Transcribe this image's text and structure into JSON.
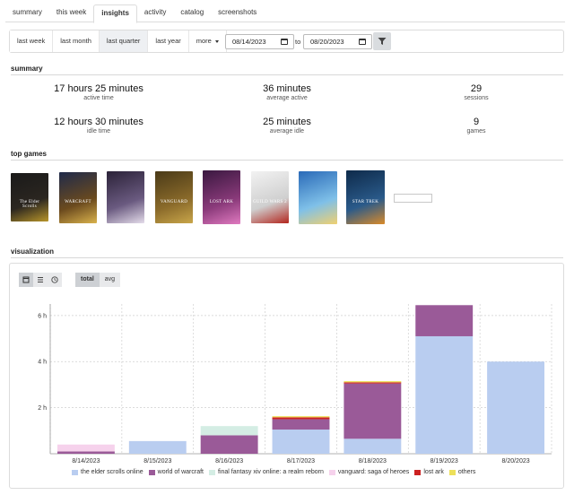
{
  "tabs": [
    {
      "label": "summary",
      "active": false
    },
    {
      "label": "this week",
      "active": false
    },
    {
      "label": "insights",
      "active": true
    },
    {
      "label": "activity",
      "active": false
    },
    {
      "label": "catalog",
      "active": false
    },
    {
      "label": "screenshots",
      "active": false
    }
  ],
  "filters": {
    "ranges": [
      "last week",
      "last month",
      "last quarter",
      "last year"
    ],
    "selected_range": "last quarter",
    "more_label": "more",
    "start_date": "08/14/2023",
    "to_label": "to",
    "end_date": "08/20/2023"
  },
  "summary": {
    "heading": "summary",
    "active_time": {
      "value": "17 hours 25 minutes",
      "label": "active time"
    },
    "average_active": {
      "value": "36 minutes",
      "label": "average active"
    },
    "sessions": {
      "value": "29",
      "label": "sessions"
    },
    "idle_time": {
      "value": "12 hours 30 minutes",
      "label": "idle time"
    },
    "average_idle": {
      "value": "25 minutes",
      "label": "average idle"
    },
    "games": {
      "value": "9",
      "label": "games"
    }
  },
  "top_games": {
    "heading": "top games",
    "covers": [
      {
        "name": "The Elder Scrolls Online",
        "cover_text": "The Elder Scrolls",
        "colors": [
          "#1a1a1a",
          "#2b2620",
          "#b8952a"
        ]
      },
      {
        "name": "World of Warcraft",
        "cover_text": "WARCRAFT",
        "colors": [
          "#1f2a4a",
          "#6b4a1e",
          "#d9b24c"
        ]
      },
      {
        "name": "Final Fantasy XIV Online",
        "cover_text": "",
        "colors": [
          "#2b2238",
          "#6a5a80",
          "#e4dcea"
        ]
      },
      {
        "name": "Vanguard: Saga of Heroes",
        "cover_text": "VANGUARD",
        "colors": [
          "#4a3a18",
          "#8a6a2a",
          "#c9a64a"
        ]
      },
      {
        "name": "Lost Ark",
        "cover_text": "LOST ARK",
        "colors": [
          "#3a1840",
          "#8a3a7a",
          "#e07ac0"
        ]
      },
      {
        "name": "Guild Wars 2",
        "cover_text": "GUILD WARS 2",
        "colors": [
          "#f2f2f2",
          "#cfcfcf",
          "#b3261e"
        ]
      },
      {
        "name": "Unknown game",
        "cover_text": "",
        "colors": [
          "#2a6ab8",
          "#7fc0e8",
          "#f0d070"
        ]
      },
      {
        "name": "Star Trek Online",
        "cover_text": "STAR TREK",
        "colors": [
          "#0e2a4a",
          "#2a5a8a",
          "#d98a2a"
        ]
      }
    ]
  },
  "visualization": {
    "heading": "visualization",
    "view_icons": [
      "calendar-icon",
      "list-icon",
      "clock-icon"
    ],
    "mode_labels": [
      "total",
      "avg"
    ],
    "selected_mode": "total"
  },
  "colors": {
    "eso": "#b9cdf0",
    "wow": "#9a5a98",
    "ffxiv": "#d4ede4",
    "vanguard": "#f6d2ec",
    "lostark": "#cc2222",
    "others": "#ede05a"
  },
  "chart_data": {
    "type": "bar",
    "stacked": true,
    "categories": [
      "8/14/2023",
      "8/15/2023",
      "8/16/2023",
      "8/17/2023",
      "8/18/2023",
      "8/19/2023",
      "8/20/2023"
    ],
    "series": [
      {
        "name": "the elder scrolls online",
        "color_key": "eso",
        "values": [
          0.0,
          0.55,
          0.0,
          1.05,
          0.65,
          5.1,
          4.0
        ]
      },
      {
        "name": "world of warcraft",
        "color_key": "wow",
        "values": [
          0.1,
          0.0,
          0.8,
          0.45,
          2.4,
          1.35,
          0.0
        ]
      },
      {
        "name": "final fantasy xiv online: a realm reborn",
        "color_key": "ffxiv",
        "values": [
          0.0,
          0.0,
          0.4,
          0.0,
          0.0,
          0.0,
          0.0
        ]
      },
      {
        "name": "vanguard: saga of heroes",
        "color_key": "vanguard",
        "values": [
          0.3,
          0.0,
          0.0,
          0.0,
          0.0,
          0.0,
          0.0
        ]
      },
      {
        "name": "lost ark",
        "color_key": "lostark",
        "values": [
          0.0,
          0.0,
          0.0,
          0.08,
          0.05,
          0.0,
          0.0
        ]
      },
      {
        "name": "others",
        "color_key": "others",
        "values": [
          0.0,
          0.0,
          0.0,
          0.05,
          0.05,
          0.0,
          0.0
        ]
      }
    ],
    "y_ticks": [
      2,
      4,
      6
    ],
    "y_tick_labels": [
      "2 h",
      "4 h",
      "6 h"
    ],
    "ylim": [
      0,
      6.5
    ],
    "grid": true,
    "legend_position": "bottom"
  }
}
